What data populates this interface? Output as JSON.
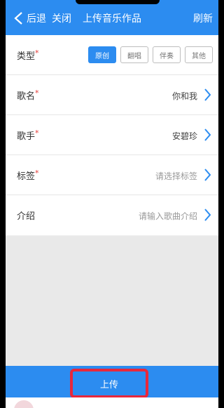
{
  "header": {
    "back_label": "后退",
    "close_label": "关闭",
    "title": "上传音乐作品",
    "refresh_label": "刷新"
  },
  "form": {
    "type": {
      "label": "类型",
      "required": "*",
      "options": [
        "原创",
        "翻唱",
        "伴奏",
        "其他"
      ],
      "selected": "原创"
    },
    "song_name": {
      "label": "歌名",
      "required": "*",
      "value": "你和我"
    },
    "singer": {
      "label": "歌手",
      "required": "*",
      "value": "安碧珍"
    },
    "tags": {
      "label": "标签",
      "required": "*",
      "placeholder": "请选择标签"
    },
    "intro": {
      "label": "介绍",
      "placeholder": "请输入歌曲介绍"
    }
  },
  "footer": {
    "upload_label": "上传"
  },
  "colors": {
    "accent": "#2c8cf0",
    "highlight": "#e8283c",
    "required": "#e53935"
  }
}
